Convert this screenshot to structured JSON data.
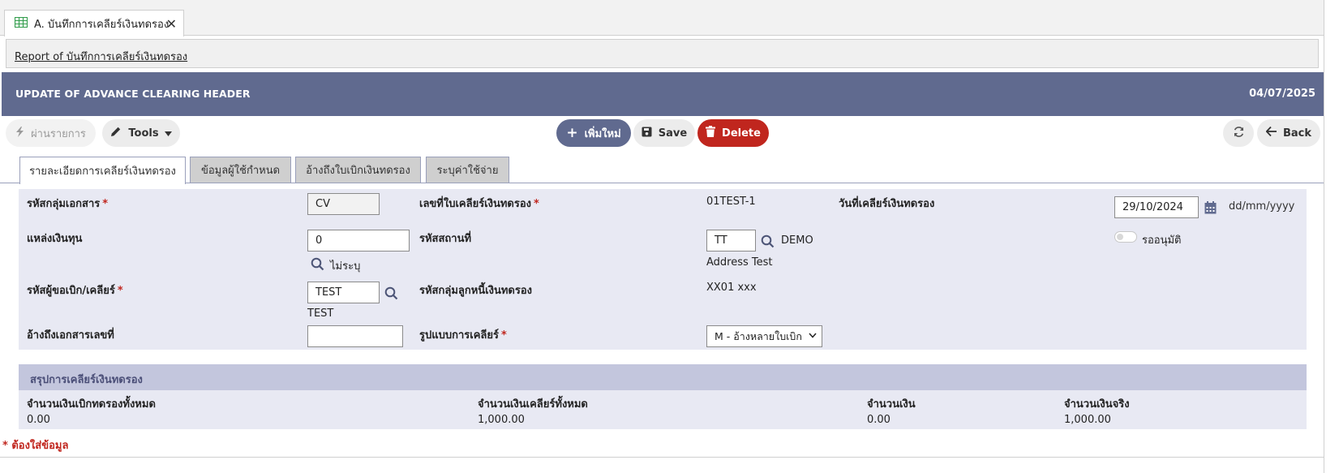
{
  "tab": {
    "icon": "table-icon",
    "label": "A. บันทึกการเคลียร์เงินทดรอง",
    "close": "✕"
  },
  "report_link": "Report of บันทึกการเคลียร์เงินทดรอง",
  "header": {
    "title": "UPDATE OF ADVANCE CLEARING HEADER",
    "date": "04/07/2025"
  },
  "toolbar": {
    "post_label": "ผ่านรายการ",
    "tools_label": "Tools",
    "add_label": "เพิ่มใหม่",
    "save_label": "Save",
    "delete_label": "Delete",
    "back_label": "Back"
  },
  "form_tabs": [
    "รายละเอียดการเคลียร์เงินทดรอง",
    "ข้อมูลผู้ใช้กำหนด",
    "อ้างถึงใบเบิกเงินทดรอง",
    "ระบุค่าใช้จ่าย"
  ],
  "fields": {
    "doc_group_label": "รหัสกลุ่มเอกสาร",
    "doc_group_value": "CV",
    "fund_label": "แหล่งเงินทุน",
    "fund_value": "0",
    "fund_desc": "ไม่ระบุ",
    "requester_label": "รหัสผู้ขอเบิก/เคลียร์",
    "requester_value": "TEST",
    "requester_desc": "TEST",
    "ref_doc_label": "อ้างถึงเอกสารเลขที่",
    "ref_doc_value": "",
    "clear_no_label": "เลขที่ใบเคลียร์เงินทดรอง",
    "clear_no_value": "01TEST-1",
    "location_label": "รหัสสถานที่",
    "location_value": "TT",
    "location_name": "DEMO",
    "location_address": "Address Test",
    "debtor_group_label": "รหัสกลุ่มลูกหนี้เงินทดรอง",
    "debtor_group_value": "XX01 xxx",
    "clear_type_label": "รูปแบบการเคลียร์",
    "clear_type_value": "M - อ้างหลายใบเบิก",
    "clear_date_label": "วันที่เคลียร์เงินทดรอง",
    "clear_date_value": "29/10/2024",
    "date_format_hint": "dd/mm/yyyy",
    "pending_label": "รออนุมัติ"
  },
  "summary": {
    "title": "สรุปการเคลียร์เงินทดรอง",
    "columns": [
      {
        "label": "จำนวนเงินเบิกทดรองทั้งหมด",
        "value": "0.00"
      },
      {
        "label": "จำนวนเงินเคลียร์ทั้งหมด",
        "value": "1,000.00"
      },
      {
        "label": "จำนวนเงิน",
        "value": "0.00"
      },
      {
        "label": "จำนวนเงินจริง",
        "value": "1,000.00"
      }
    ]
  },
  "required_note": "* ต้องใส่ข้อมูล",
  "colors": {
    "header_bg": "#606a8f",
    "danger": "#c0261e",
    "panel_bg": "#e8e9f3",
    "summary_head": "#c3c6dd"
  }
}
